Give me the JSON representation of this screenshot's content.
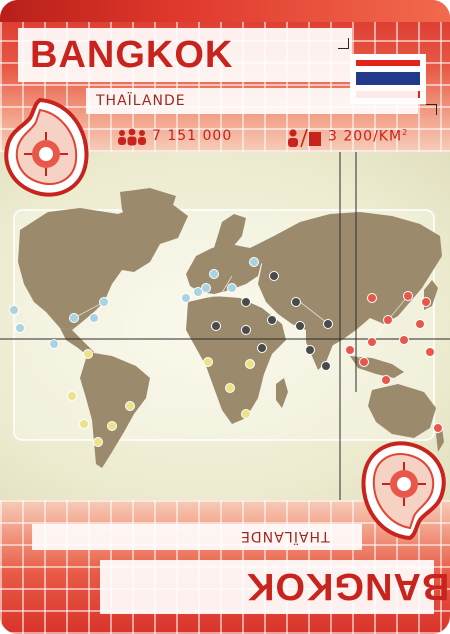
{
  "card": {
    "city": "BANGKOK",
    "country": "THAÏLANDE",
    "population": "7 151 000",
    "density": "3 200/KM",
    "density_exp": "2"
  },
  "colors": {
    "red": "#c8231c",
    "blue_dot": "#a9d3e0",
    "black_dot": "#4a4a4a",
    "yellow_dot": "#ece28a",
    "red_dot": "#e8574a"
  },
  "icons": {
    "population": "people-group-icon",
    "density": "person-per-area-icon",
    "ornament": "paisley-icon",
    "flag": "thailand-flag-icon"
  }
}
